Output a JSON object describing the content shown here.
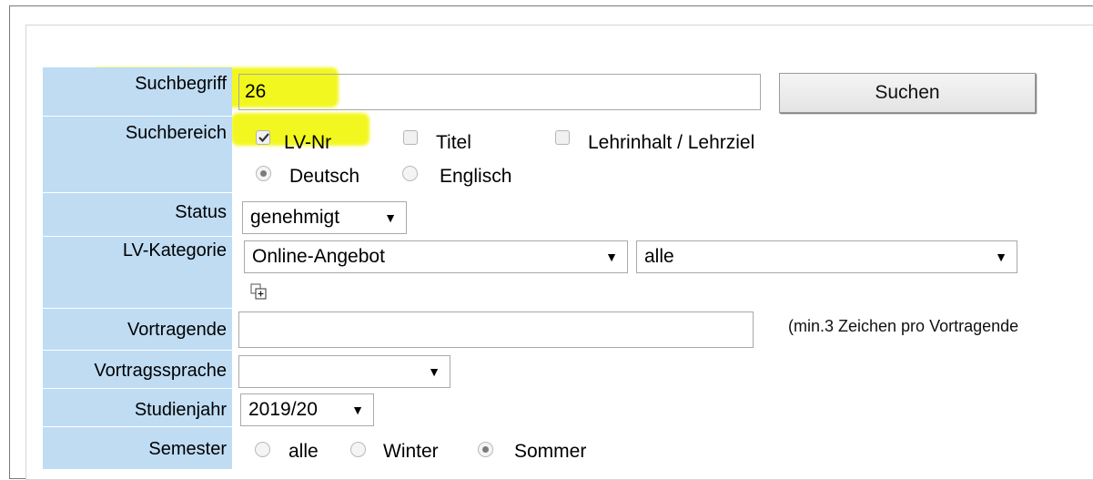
{
  "form": {
    "suchbegriff": {
      "label": "Suchbegriff",
      "value": "26"
    },
    "search_button": "Suchen",
    "suchbereich": {
      "label": "Suchbereich",
      "options": [
        {
          "label": "LV-Nr",
          "checked": true
        },
        {
          "label": "Titel",
          "checked": false
        },
        {
          "label": "Lehrinhalt / Lehrziel",
          "checked": false
        }
      ],
      "language": {
        "options": [
          "Deutsch",
          "Englisch"
        ],
        "selected": "Deutsch"
      }
    },
    "status": {
      "label": "Status",
      "value": "genehmigt"
    },
    "lv_kategorie": {
      "label": "LV-Kategorie",
      "value": "Online-Angebot",
      "sub_value": "alle"
    },
    "vortragende": {
      "label": "Vortragende",
      "value": "",
      "hint": "(min.3 Zeichen pro Vortragende"
    },
    "vortragssprache": {
      "label": "Vortragssprache",
      "value": ""
    },
    "studienjahr": {
      "label": "Studienjahr",
      "value": "2019/20"
    },
    "semester": {
      "label": "Semester",
      "options": [
        "alle",
        "Winter",
        "Sommer"
      ],
      "selected": "Sommer"
    }
  },
  "icons": {
    "expand": "plus-box-icon",
    "dropdown": "triangle-down-icon"
  },
  "colors": {
    "label_bg": "#bfdcf3",
    "highlight": "#f2f714"
  }
}
